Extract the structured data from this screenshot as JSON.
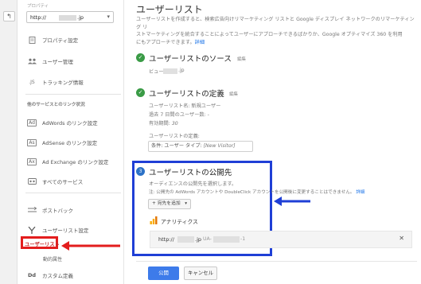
{
  "sidebar": {
    "property_label": "プロパティ",
    "property_value_prefix": "http://",
    "property_value_suffix": ".jp",
    "items": [
      {
        "label": "プロパティ設定",
        "icon": "page-icon"
      },
      {
        "label": "ユーザー管理",
        "icon": "users-icon"
      },
      {
        "label": "トラッキング情報",
        "icon": "js-icon"
      }
    ],
    "section_label": "他のサービスとのリンク状況",
    "links": [
      {
        "label": "AdWords のリンク設定",
        "icon": "adwords-icon"
      },
      {
        "label": "AdSense のリンク設定",
        "icon": "adsense-icon"
      },
      {
        "label": "Ad Exchange のリンク設定",
        "icon": "adexchange-icon"
      },
      {
        "label": "すべてのサービス",
        "icon": "all-services-icon"
      }
    ],
    "postback": "ポストバック",
    "audience_settings": "ユーザーリスト設定",
    "user_list": "ユーザーリスト",
    "dynamic_attributes": "動的属性",
    "custom_definitions": "カスタム定義",
    "custom_icon_text": "Dd"
  },
  "main": {
    "title": "ユーザーリスト",
    "intro_line1": "ユーザーリストを作成すると、検索広告向けリマーケティング リストと Google ディスプレイ ネットワークのリマーケティング リ",
    "intro_line2": "ストマーケティングを統合することによってユーザーにアプローチできるばかりか、Google オプティマイズ 360 を利用",
    "intro_line3": "にもアプローチできます。",
    "intro_link": "詳細",
    "step1": {
      "title": "ユーザーリストのソース",
      "edit": "編集",
      "view_label": "ビュー:",
      "view_suffix": ".jp"
    },
    "step2": {
      "title": "ユーザーリストの定義",
      "edit": "編集",
      "name": "ユーザーリスト名: 新規ユーザー",
      "duration": "過去 7 日間のユーザー数: -",
      "membership_label": "有効期間: ",
      "membership_value": "30",
      "definition_label": "ユーザーリストの定義:",
      "condition": "条件: ユーザー タイプ: ",
      "condition_value": "[New Visitor]"
    },
    "step3": {
      "number": "3",
      "title": "ユーザーリストの公開先",
      "desc": "オーディエンスの公開先を選択します。",
      "note": "注: 公開先の AdWords アカウントや DoubleClick アカウントを公開後に変更することはできません。",
      "note_link": "詳細",
      "add_button": "+ 宛先を追加",
      "analytics_label": "アナリティクス",
      "row_prefix": "http://",
      "row_suffix": ".jp",
      "row_ua": "UA-",
      "row_num": "-1"
    },
    "publish_button": "公開",
    "cancel_button": "キャンセル"
  },
  "colors": {
    "highlight_red": "#e31d1d",
    "highlight_blue": "#1f3fd6",
    "primary_button": "#3d7bea",
    "step_check": "#3a9b46",
    "step_active": "#2c72c7"
  }
}
